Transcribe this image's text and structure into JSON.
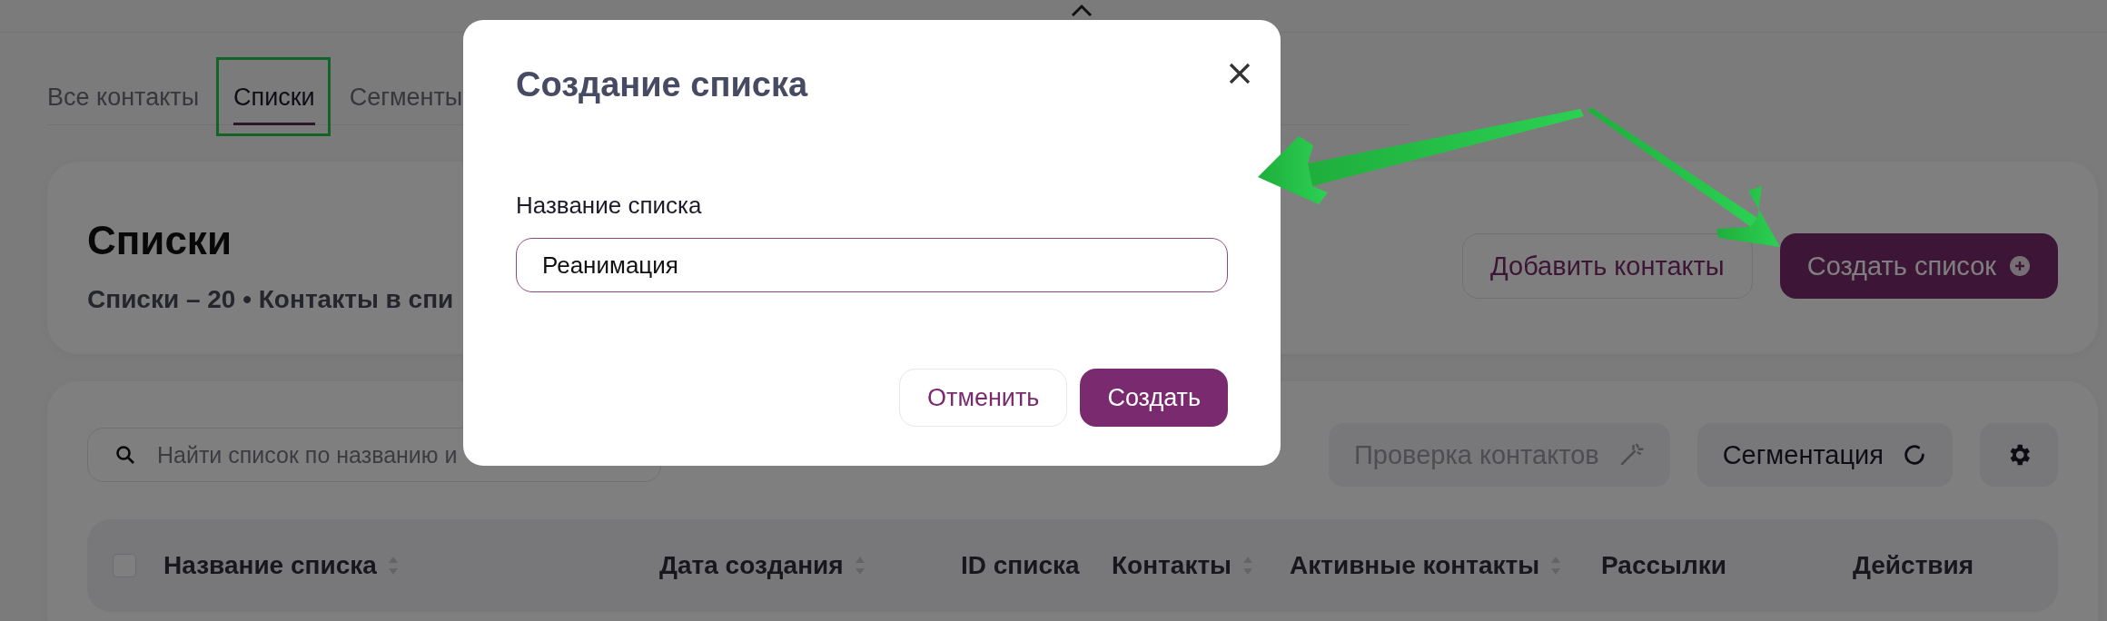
{
  "tabs": [
    {
      "label": "Все контакты",
      "selected": false
    },
    {
      "label": "Списки",
      "selected": true
    },
    {
      "label": "Сегменты",
      "selected": false
    }
  ],
  "header": {
    "title": "Списки",
    "summary": "Списки – 20 • Контакты в спи",
    "buttons": [
      {
        "label": "Добавить контакты",
        "kind": "outline"
      },
      {
        "label": "Создать список",
        "kind": "primary"
      }
    ]
  },
  "toolbar": {
    "search": {
      "placeholder": "Найти список по названию и"
    },
    "buttons": [
      {
        "label": "Проверка контактов",
        "kind": "wand",
        "disabled": true
      },
      {
        "label": "Сегментация",
        "kind": "refresh",
        "disabled": false
      },
      {
        "kind": "settings",
        "disabled": false
      }
    ]
  },
  "table": {
    "select_all": {
      "checked": false
    },
    "columns": [
      {
        "label": "Название списка",
        "sortable": true
      },
      {
        "label": "Дата создания",
        "sortable": true
      },
      {
        "label": "ID списка",
        "sortable": false
      },
      {
        "label": "Контакты",
        "sortable": true
      },
      {
        "label": "Активные контакты",
        "sortable": true
      },
      {
        "label": "Рассылки",
        "sortable": false
      },
      {
        "label": "Действия",
        "sortable": false
      }
    ]
  },
  "dialog": {
    "title": "Создание списка",
    "field": {
      "label": "Название списка",
      "value": "Реанимация"
    },
    "buttons": [
      {
        "label": "Отменить",
        "kind": "secondary"
      },
      {
        "label": "Создать",
        "kind": "primary"
      }
    ]
  }
}
